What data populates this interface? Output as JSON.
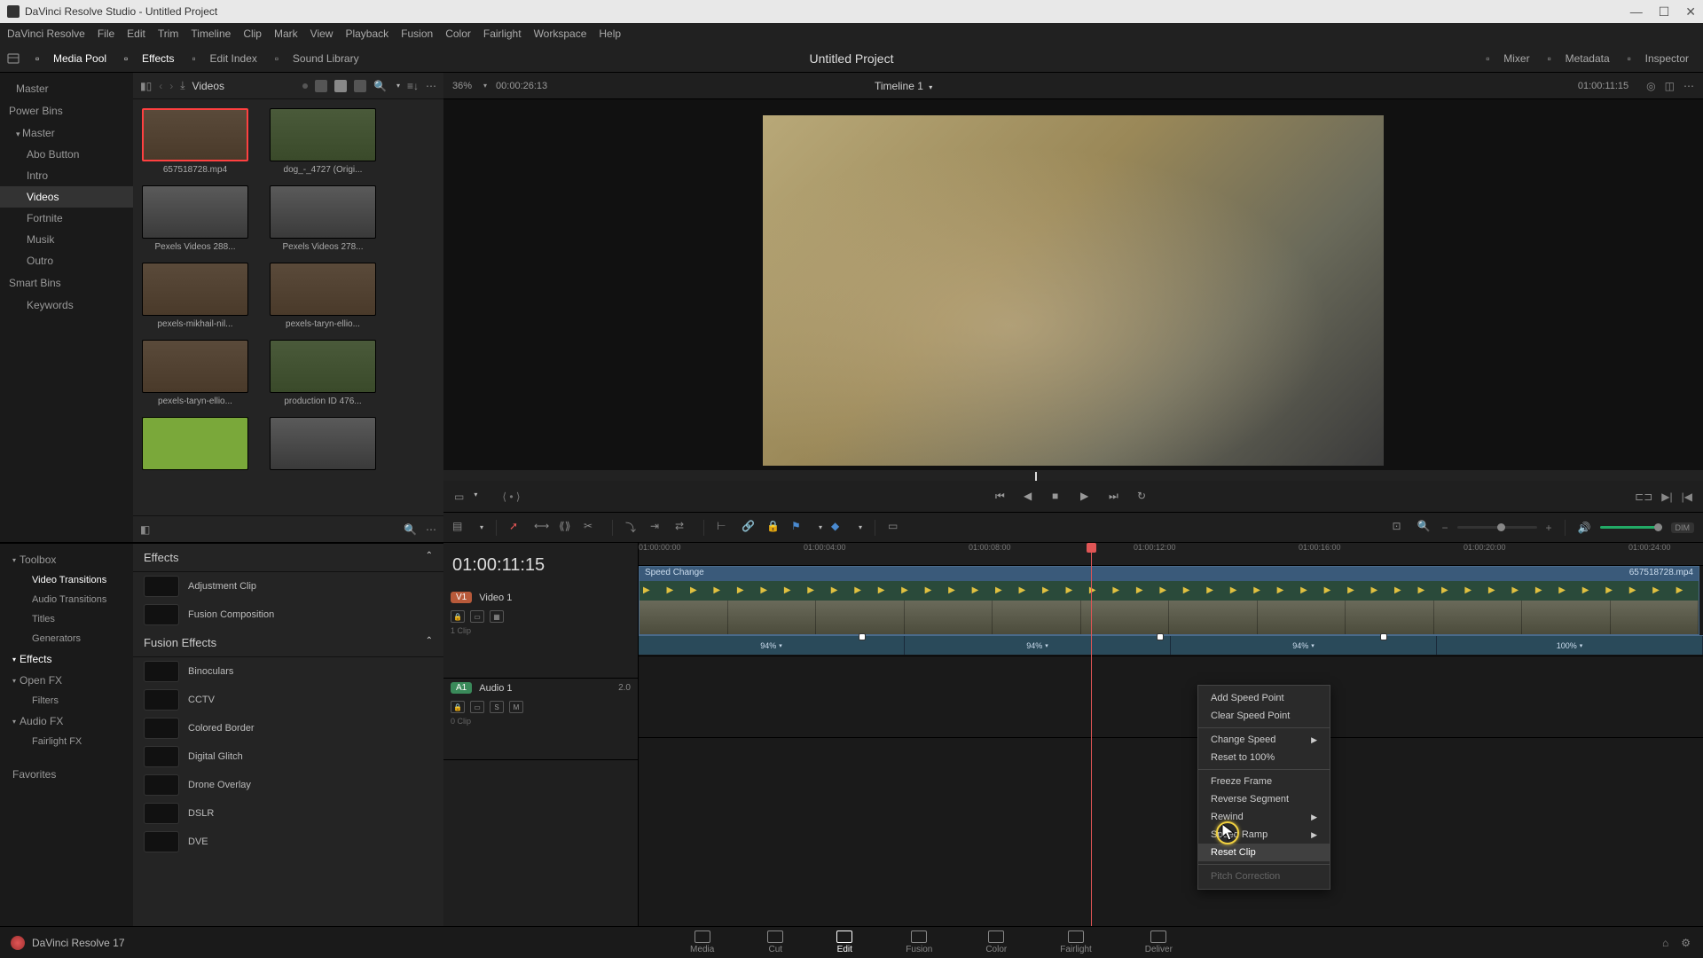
{
  "titlebar": {
    "text": "DaVinci Resolve Studio - Untitled Project"
  },
  "menubar": [
    "DaVinci Resolve",
    "File",
    "Edit",
    "Trim",
    "Timeline",
    "Clip",
    "Mark",
    "View",
    "Playback",
    "Fusion",
    "Color",
    "Fairlight",
    "Workspace",
    "Help"
  ],
  "toptool": {
    "left": [
      {
        "id": "media-pool",
        "label": "Media Pool",
        "active": true
      },
      {
        "id": "effects",
        "label": "Effects",
        "active": true
      },
      {
        "id": "edit-index",
        "label": "Edit Index",
        "active": false
      },
      {
        "id": "sound-library",
        "label": "Sound Library",
        "active": false
      }
    ],
    "project_title": "Untitled Project",
    "right": [
      {
        "id": "mixer",
        "label": "Mixer"
      },
      {
        "id": "metadata",
        "label": "Metadata"
      },
      {
        "id": "inspector",
        "label": "Inspector"
      }
    ]
  },
  "mediapool": {
    "nav": {
      "master": "Master",
      "power_bins": "Power Bins",
      "pb_master": "Master",
      "pb_items": [
        "Abo Button",
        "Intro",
        "Videos",
        "Fortnite",
        "Musik",
        "Outro"
      ],
      "pb_selected": "Videos",
      "smart_bins": "Smart Bins",
      "sb_items": [
        "Keywords"
      ]
    },
    "breadcrumb": "Videos",
    "clips": [
      {
        "name": "657518728.mp4",
        "sel": true,
        "cls": "brown"
      },
      {
        "name": "dog_-_4727 (Origi...",
        "cls": "green"
      },
      {
        "name": "Pexels Videos 288...",
        "cls": "grey"
      },
      {
        "name": "Pexels Videos 278...",
        "cls": "grey"
      },
      {
        "name": "pexels-mikhail-nil...",
        "cls": "brown"
      },
      {
        "name": "pexels-taryn-ellio...",
        "cls": "brown"
      },
      {
        "name": "pexels-taryn-ellio...",
        "cls": "brown"
      },
      {
        "name": "production ID 476...",
        "cls": "green"
      },
      {
        "name": "",
        "cls": "lime"
      },
      {
        "name": "",
        "cls": "grey"
      }
    ]
  },
  "effects_nav": [
    {
      "label": "Toolbox",
      "expand": true
    },
    {
      "label": "Video Transitions",
      "sub": true,
      "sel": true
    },
    {
      "label": "Audio Transitions",
      "sub": true
    },
    {
      "label": "Titles",
      "sub": true
    },
    {
      "label": "Generators",
      "sub": true
    },
    {
      "label": "Effects",
      "expand": true,
      "sel": true
    },
    {
      "label": "Open FX",
      "expand": true
    },
    {
      "label": "Filters",
      "sub": true
    },
    {
      "label": "Audio FX",
      "expand": true
    },
    {
      "label": "Fairlight FX",
      "sub": true
    },
    {
      "label": "Favorites",
      "hdr": true
    }
  ],
  "effects_panel": {
    "section1": "Effects",
    "items1": [
      "Adjustment Clip",
      "Fusion Composition"
    ],
    "section2": "Fusion Effects",
    "items2": [
      "Binoculars",
      "CCTV",
      "Colored Border",
      "Digital Glitch",
      "Drone Overlay",
      "DSLR",
      "DVE"
    ]
  },
  "viewer": {
    "zoom": "36%",
    "src_tc": "00:00:26:13",
    "timeline_name": "Timeline 1",
    "tc": "01:00:11:15"
  },
  "timeline": {
    "big_tc": "01:00:11:15",
    "ruler": [
      "01:00:00:00",
      "01:00:04:00",
      "01:00:08:00",
      "01:00:12:00",
      "01:00:16:00",
      "01:00:20:00",
      "01:00:24:00"
    ],
    "v1": {
      "badge": "V1",
      "name": "Video 1",
      "clips": "1 Clip"
    },
    "a1": {
      "badge": "A1",
      "name": "Audio 1",
      "ch": "2.0",
      "clips": "0 Clip",
      "s": "S",
      "m": "M"
    },
    "clip": {
      "title": "Speed Change",
      "filename": "657518728.mp4"
    },
    "speeds": [
      "94%",
      "94%",
      "94%",
      "100%"
    ]
  },
  "ctx": [
    {
      "label": "Add Speed Point"
    },
    {
      "label": "Clear Speed Point"
    },
    {
      "sep": true
    },
    {
      "label": "Change Speed",
      "sub": true
    },
    {
      "label": "Reset to 100%"
    },
    {
      "sep": true
    },
    {
      "label": "Freeze Frame"
    },
    {
      "label": "Reverse Segment"
    },
    {
      "label": "Rewind",
      "sub": true
    },
    {
      "label": "Speed Ramp",
      "sub": true
    },
    {
      "label": "Reset Clip",
      "sel": true
    },
    {
      "sep": true
    },
    {
      "label": "Pitch Correction",
      "dis": true
    }
  ],
  "bottom": {
    "app": "DaVinci Resolve 17",
    "pages": [
      "Media",
      "Cut",
      "Edit",
      "Fusion",
      "Color",
      "Fairlight",
      "Deliver"
    ],
    "active": "Edit"
  },
  "dim": "DIM"
}
